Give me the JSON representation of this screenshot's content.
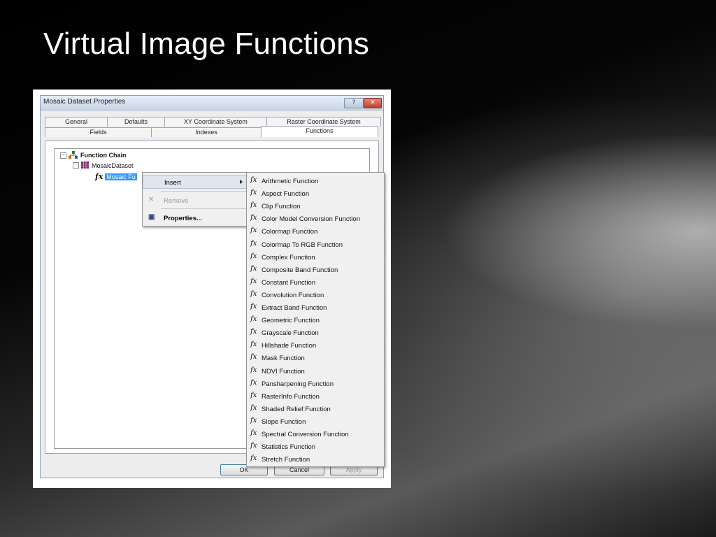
{
  "slide": {
    "title": "Virtual Image Functions"
  },
  "dialog": {
    "title": "Mosaic Dataset Properties",
    "help_label": "?",
    "close_label": "✕",
    "tabs_row1": [
      "General",
      "Defaults",
      "XY Coordinate System",
      "Raster Coordinate System"
    ],
    "tabs_row2": [
      "Fields",
      "Indexes",
      "Functions"
    ],
    "active_tab": "Functions",
    "tree": {
      "root_expander": "−",
      "root_label": "Function Chain",
      "child_expander": "−",
      "child_label": "MosaicDataset",
      "fx_glyph": "fx",
      "leaf_label": "Mosaic Fu"
    },
    "buttons": {
      "ok": "OK",
      "cancel": "Cancel",
      "apply": "Apply"
    }
  },
  "context_menu": {
    "insert": "Insert",
    "remove": "Remove",
    "remove_icon": "✕",
    "properties": "Properties...",
    "properties_icon": "▣"
  },
  "submenu": {
    "fx_glyph": "fx",
    "items": [
      "Arithmetic Function",
      "Aspect Function",
      "Clip Function",
      "Color Model Conversion Function",
      "Colormap Function",
      "Colormap To RGB Function",
      "Complex Function",
      "Composite Band Function",
      "Constant Function",
      "Convolution Function",
      "Extract Band Function",
      "Geometric Function",
      "Grayscale Function",
      "Hillshade Function",
      "Mask Function",
      "NDVI Function",
      "Pansharpening Function",
      "RasterInfo Function",
      "Shaded Relief Function",
      "Slope Function",
      "Spectral Conversion Function",
      "Statistics Function",
      "Stretch Function"
    ]
  },
  "colors": {
    "selection": "#3399ff",
    "titlebar": "#c9d6e8"
  }
}
